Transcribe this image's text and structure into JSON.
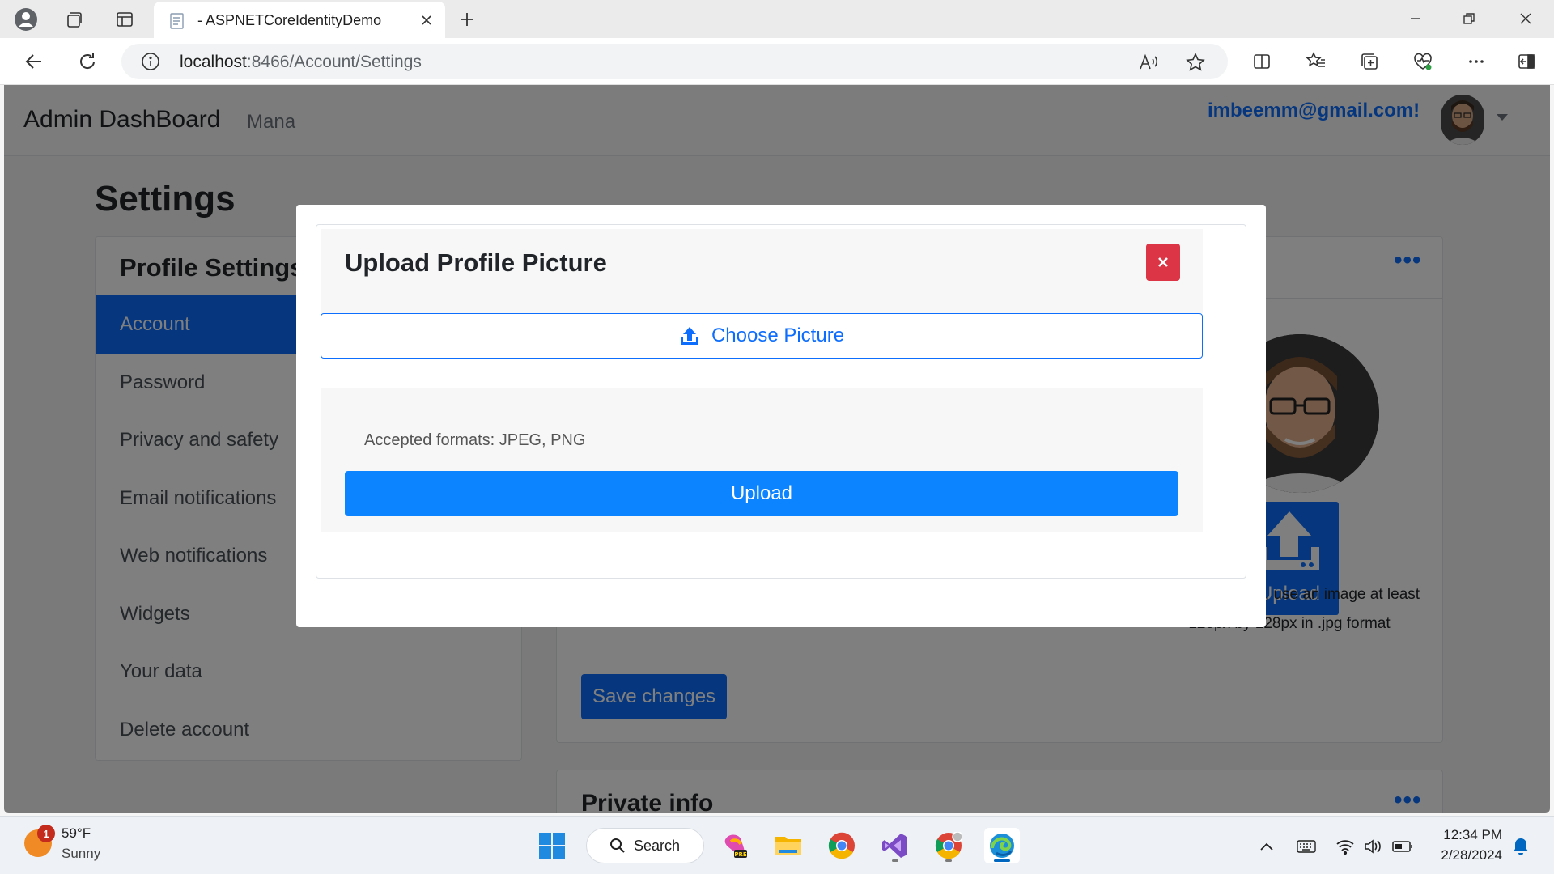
{
  "browser": {
    "tab_title": "- ASPNETCoreIdentityDemo",
    "url_host": "localhost",
    "url_path": ":8466/Account/Settings"
  },
  "page": {
    "brand": "Admin DashBoard",
    "nav_manage": "Mana",
    "user_email": "imbeemm@gmail.com!",
    "settings_title": "Settings",
    "sidebar": {
      "title": "Profile Settings",
      "items": [
        {
          "label": "Account",
          "active": true
        },
        {
          "label": "Password"
        },
        {
          "label": "Privacy and safety"
        },
        {
          "label": "Email notifications"
        },
        {
          "label": "Web notifications"
        },
        {
          "label": "Widgets"
        },
        {
          "label": "Your data"
        },
        {
          "label": "Delete account"
        }
      ]
    },
    "upload_tile_label": "Upload",
    "hint_text": "For best results, use an image at least 128px by 128px in .jpg format",
    "save_label": "Save changes",
    "private_info_title": "Private info"
  },
  "modal": {
    "title": "Upload Profile Picture",
    "choose_label": "Choose Picture",
    "formats_text": "Accepted formats: JPEG, PNG",
    "upload_label": "Upload"
  },
  "taskbar": {
    "weather_temp": "59°F",
    "weather_desc": "Sunny",
    "weather_badge": "1",
    "search_label": "Search",
    "time": "12:34 PM",
    "date": "2/28/2024"
  },
  "colors": {
    "primary": "#0d6efd",
    "danger": "#dc3545",
    "upload_button": "#0d84ff"
  }
}
